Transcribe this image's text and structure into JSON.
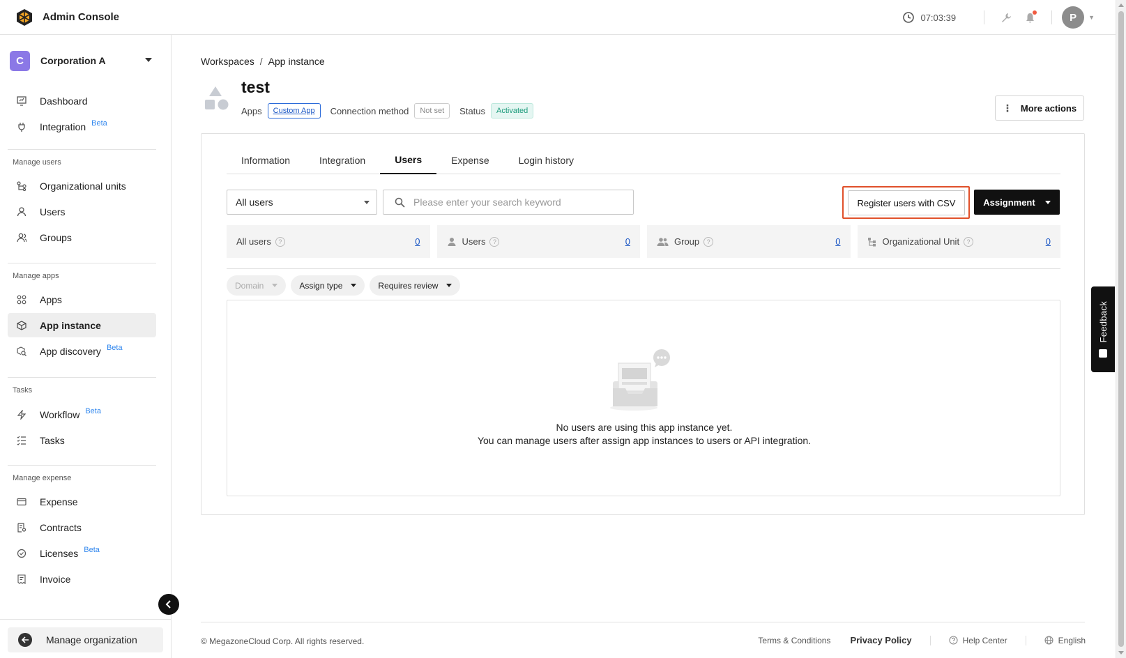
{
  "header": {
    "app_title": "Admin Console",
    "time": "07:03:39",
    "avatar_initial": "P",
    "accent_notification": "#f05a40"
  },
  "sidebar": {
    "org_initial": "C",
    "org_name": "Corporation A",
    "org_color": "#8b78e6",
    "top_items": [
      {
        "label": "Dashboard",
        "icon": "dashboard-icon"
      },
      {
        "label": "Integration",
        "icon": "plug-icon",
        "badge": "Beta"
      }
    ],
    "sections": {
      "manage_users": "Manage users",
      "manage_apps": "Manage apps",
      "tasks": "Tasks",
      "manage_expense": "Manage expense"
    },
    "items": {
      "org_units": "Organizational units",
      "users": "Users",
      "groups": "Groups",
      "apps": "Apps",
      "app_instance": "App instance",
      "app_discovery": "App discovery",
      "workflow": "Workflow",
      "tasks": "Tasks",
      "expense": "Expense",
      "contracts": "Contracts",
      "licenses": "Licenses",
      "invoice": "Invoice"
    },
    "beta_label": "Beta",
    "manage_org": "Manage organization"
  },
  "breadcrumb": {
    "root": "Workspaces",
    "sep": "/",
    "current": "App instance"
  },
  "page": {
    "title": "test",
    "apps_label": "Apps",
    "apps_value": "Custom App",
    "connection_label": "Connection method",
    "connection_value": "Not set",
    "status_label": "Status",
    "status_value": "Activated",
    "more_actions": "More actions"
  },
  "tabs": [
    "Information",
    "Integration",
    "Users",
    "Expense",
    "Login history"
  ],
  "toolbar": {
    "filter_value": "All users",
    "search_placeholder": "Please enter your search keyword",
    "csv_button": "Register users with CSV",
    "assignment_button": "Assignment"
  },
  "stats": [
    {
      "label": "All users",
      "count": "0"
    },
    {
      "label": "Users",
      "count": "0"
    },
    {
      "label": "Group",
      "count": "0"
    },
    {
      "label": "Organizational Unit",
      "count": "0"
    }
  ],
  "chips": [
    "Domain",
    "Assign type",
    "Requires review"
  ],
  "empty": {
    "line1": "No users are using this app instance yet.",
    "line2": "You can manage users after assign app instances to users or API integration."
  },
  "footer": {
    "copyright": "© MegazoneCloud Corp. All rights reserved.",
    "terms": "Terms & Conditions",
    "privacy": "Privacy Policy",
    "help": "Help Center",
    "language": "English"
  },
  "feedback_label": "Feedback"
}
